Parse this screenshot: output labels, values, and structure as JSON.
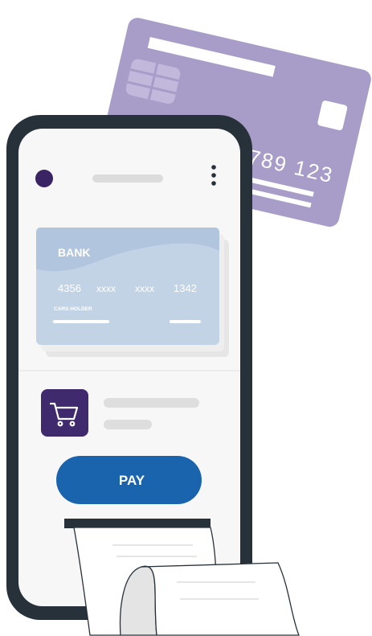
{
  "back_card": {
    "number_fragment": "789 123",
    "color": "#a89cc8"
  },
  "bank_card": {
    "bank_name": "BANK",
    "number_groups": [
      "4356",
      "xxxx",
      "xxxx",
      "1342"
    ],
    "holder_label": "CARS HOLDER",
    "color": "#c3d3e6"
  },
  "header": {
    "avatar_color": "#3a2463",
    "menu_icon": "vertical-dots-icon"
  },
  "product": {
    "icon": "shopping-cart-icon",
    "icon_bg": "#3f2a6d"
  },
  "pay_button": {
    "label": "PAY",
    "color": "#1a63ad"
  },
  "phone": {
    "frame_color": "#27313a",
    "screen_color": "#f7f7f7"
  }
}
